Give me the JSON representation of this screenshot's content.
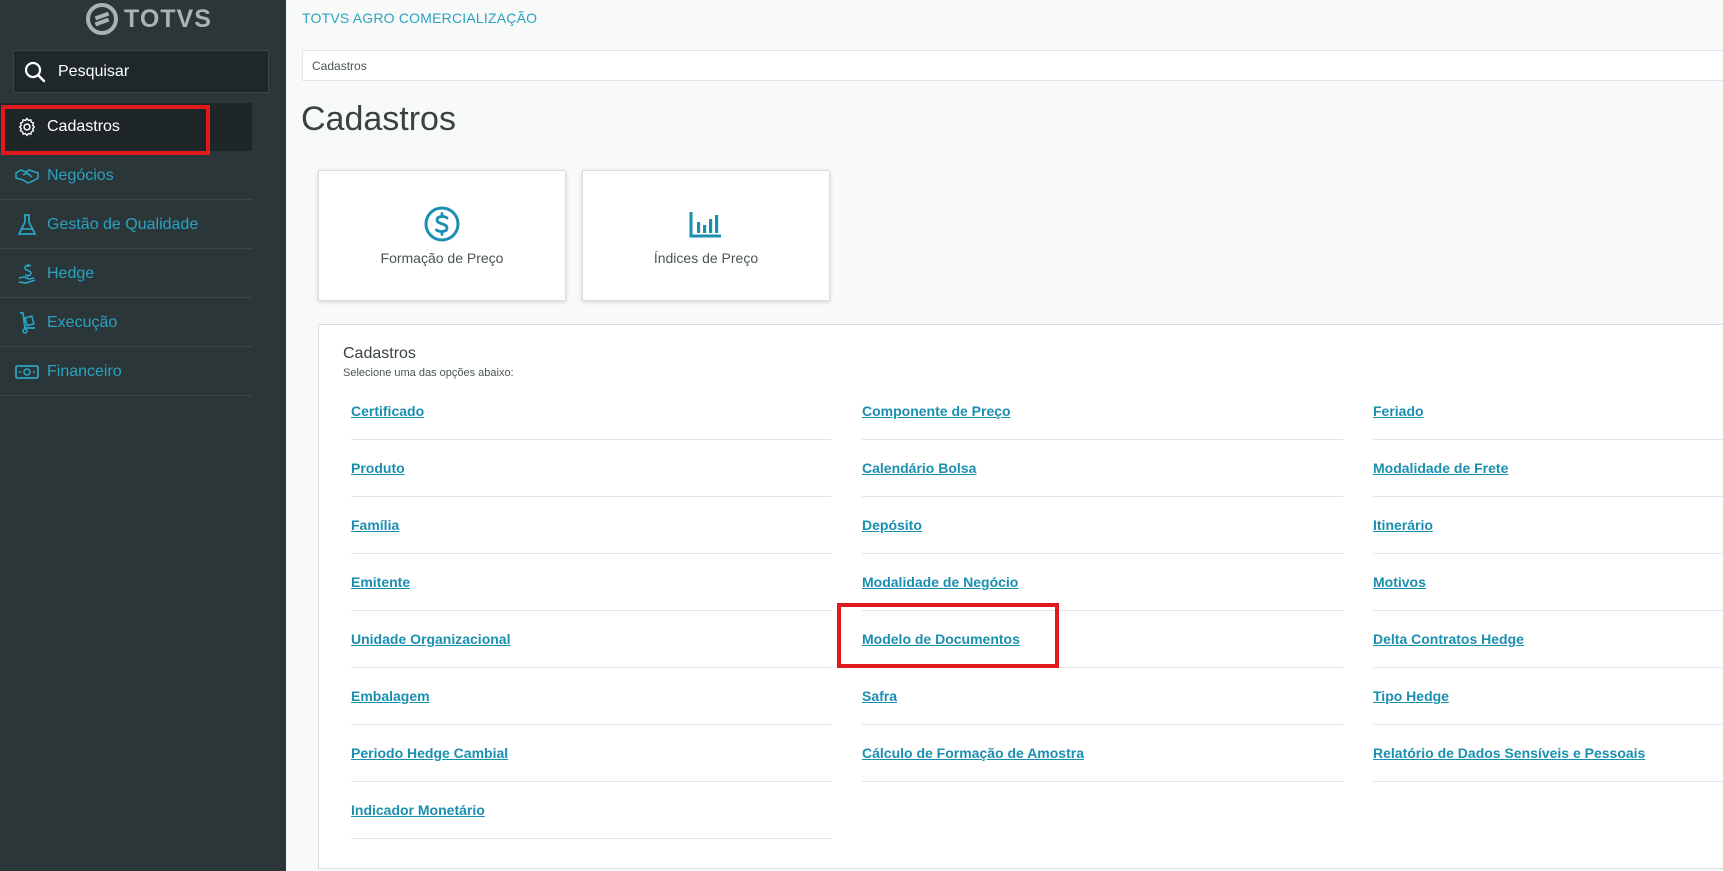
{
  "sidebar": {
    "logo_text": "TOTVS",
    "search_label": "Pesquisar",
    "items": [
      {
        "label": "Cadastros",
        "icon": "gear-icon"
      },
      {
        "label": "Negócios",
        "icon": "handshake-icon"
      },
      {
        "label": "Gestão de Qualidade",
        "icon": "flask-icon"
      },
      {
        "label": "Hedge",
        "icon": "hand-dollar-icon"
      },
      {
        "label": "Execução",
        "icon": "hand-truck-icon"
      },
      {
        "label": "Financeiro",
        "icon": "banknote-icon"
      }
    ]
  },
  "header": {
    "app_title": "TOTVS AGRO COMERCIALIZAÇÃO",
    "breadcrumb": "Cadastros",
    "page_title": "Cadastros"
  },
  "cards": [
    {
      "label": "Formação de Preço",
      "icon": "dollar-circle-icon"
    },
    {
      "label": "Índices de Preço",
      "icon": "bar-chart-icon"
    }
  ],
  "panel": {
    "title": "Cadastros",
    "subtitle": "Selecione uma das opções abaixo:",
    "columns": [
      [
        "Certificado",
        "Produto",
        "Família",
        "Emitente",
        "Unidade Organizacional",
        "Embalagem",
        "Periodo Hedge Cambial",
        "Indicador Monetário"
      ],
      [
        "Componente de Preço",
        "Calendário Bolsa",
        "Depósito",
        "Modalidade de Negócio",
        "Modelo de Documentos",
        "Safra",
        "Cálculo de Formação de Amostra"
      ],
      [
        "Feriado",
        "Modalidade de Frete",
        "Itinerário",
        "Motivos",
        "Delta Contratos Hedge",
        "Tipo Hedge",
        "Relatório de Dados Sensíveis e Pessoais"
      ]
    ]
  },
  "colors": {
    "accent": "#2aa3c2",
    "link": "#1a8fb0",
    "sidebar_bg": "#2b3638",
    "highlight": "#e0191c"
  }
}
